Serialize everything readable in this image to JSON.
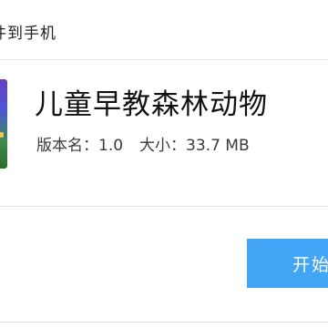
{
  "window": {
    "title": "件到手机"
  },
  "app": {
    "name": "儿童早教森林动物",
    "version_label": "版本名：",
    "version_value": "1.0",
    "size_label": "大小：",
    "size_value": "33.7 MB",
    "icon": "app-icon"
  },
  "actions": {
    "start_label": "开始",
    "accent_color": "#42a5f5"
  }
}
